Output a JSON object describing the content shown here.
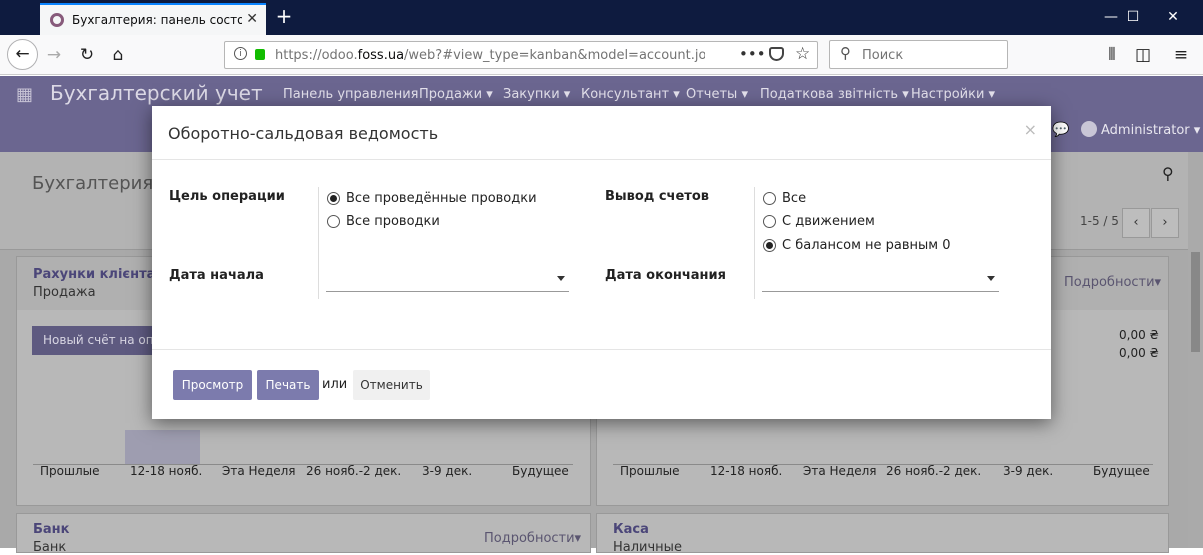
{
  "browser": {
    "tab_title": "Бухгалтерия: панель состояния",
    "url_host_prefix": "https://odoo.",
    "url_host_main": "foss.ua",
    "url_path": "/web?#view_type=kanban&model=account.journa",
    "search_placeholder": "Поиск"
  },
  "app": {
    "brand": "Бухгалтерский учет",
    "menu": [
      "Панель управления",
      "Продажи ▾",
      "Закупки ▾",
      "Консультант ▾",
      "Отчеты ▾",
      "Податкова звітність ▾",
      "Настройки ▾"
    ],
    "user": "Administrator ▾",
    "breadcrumb": "Бухгалтерия: п",
    "pager": "1-5 / 5"
  },
  "cards": [
    {
      "title": "Рахунки клієнтам",
      "subtitle": "Продажа",
      "more": "Подробности▾",
      "button": "Новый счёт на опла"
    },
    {
      "more": "Подробности▾",
      "amounts": [
        "0,00 ₴",
        "0,00 ₴"
      ]
    },
    {
      "title": "Банк",
      "subtitle": "Банк",
      "more": "Подробности▾"
    },
    {
      "title": "Каса",
      "subtitle": "Наличные"
    }
  ],
  "chart_axis": [
    "Прошлые",
    "12-18 нояб.",
    "Эта Неделя",
    "26 нояб.-2 дек.",
    "3-9 дек.",
    "Будущее"
  ],
  "modal": {
    "title": "Оборотно-сальдовая ведомость",
    "close": "×",
    "target_label": "Цель операции",
    "target_options": [
      "Все проведённые проводки",
      "Все проводки"
    ],
    "target_selected": 0,
    "display_label": "Вывод счетов",
    "display_options": [
      "Все",
      "С движением",
      "С балансом не равным 0"
    ],
    "display_selected": 2,
    "date_from_label": "Дата начала",
    "date_to_label": "Дата окончания",
    "buttons": {
      "view": "Просмотр",
      "print": "Печать",
      "or": "или",
      "cancel": "Отменить"
    }
  }
}
